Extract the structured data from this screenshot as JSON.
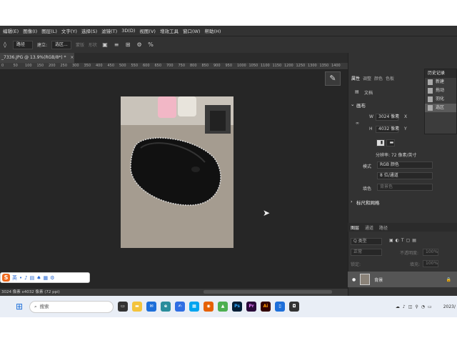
{
  "menu": [
    "编辑(E)",
    "图像(I)",
    "图层(L)",
    "文字(Y)",
    "选择(S)",
    "滤镜(T)",
    "3D(D)",
    "视图(V)",
    "增效工具",
    "窗口(W)",
    "帮助(H)"
  ],
  "options": {
    "mode": "路径",
    "build": "建立:",
    "selection": "选区...",
    "mask": "蒙版",
    "shape": "形状"
  },
  "document_tab": {
    "title": "_7336.JPG @ 13.9%(RGB/8*) *",
    "close": "×"
  },
  "ruler_ticks": [
    "0",
    "50",
    "100",
    "150",
    "200",
    "250",
    "300",
    "350",
    "400",
    "450",
    "500",
    "550",
    "600",
    "650",
    "700",
    "750",
    "800",
    "850",
    "900",
    "950",
    "1000",
    "1050",
    "1100",
    "1150",
    "1200",
    "1250",
    "1300",
    "1350",
    "1400"
  ],
  "status": "3024 像素 x4032 像素 (72 ppi)",
  "panel_tabs": [
    "属性",
    "调整",
    "颜色",
    "色板"
  ],
  "history": {
    "title": "历史记录",
    "items": [
      "新建",
      "拖动",
      "羽化",
      "选区"
    ]
  },
  "properties": {
    "doc_label": "文档",
    "canvas_heading": "画布",
    "w_label": "W",
    "w_value": "3024 像素",
    "x_label": "X",
    "h_label": "H",
    "h_value": "4032 像素",
    "y_label": "Y",
    "resolution": "分辨率: 72 像素/英寸",
    "mode_label": "模式",
    "mode_value": "RGB 颜色",
    "depth_value": "8 位/通道",
    "fill_label": "填色",
    "fill_value": "背景色",
    "rulers_heading": "标尺和网格"
  },
  "layers": {
    "tabs": [
      "图层",
      "通道",
      "路径"
    ],
    "kind": "Q 类型",
    "blend": "正常",
    "opacity_label": "不透明度:",
    "opacity_value": "100%",
    "lock_label": "锁定:",
    "fill_label": "填充:",
    "fill_value": "100%",
    "layer_name": "背景"
  },
  "taskbar": {
    "search": "搜索",
    "ime": "英",
    "clock": "2023/"
  }
}
